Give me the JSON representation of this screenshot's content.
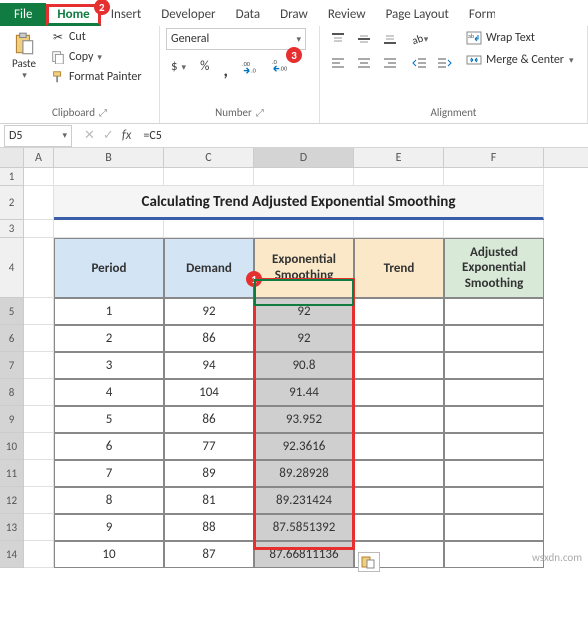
{
  "tabs": {
    "file": "File",
    "home": "Home",
    "insert": "Insert",
    "developer": "Developer",
    "data": "Data",
    "draw": "Draw",
    "review": "Review",
    "page_layout": "Page Layout",
    "formulas_partial": "Form"
  },
  "ribbon": {
    "clipboard": {
      "label": "Clipboard",
      "paste": "Paste",
      "cut": "Cut",
      "copy": "Copy",
      "format_painter": "Format Painter"
    },
    "number": {
      "label": "Number",
      "format": "General",
      "currency": "$",
      "percent": "%",
      "comma": ",",
      "inc_dec": "Increase Decimal",
      "dec_dec": "Decrease Decimal"
    },
    "alignment": {
      "label": "Alignment",
      "wrap": "Wrap Text",
      "merge": "Merge & Center"
    }
  },
  "namebox": "D5",
  "formula": "=C5",
  "columns": [
    "A",
    "B",
    "C",
    "D",
    "E",
    "F"
  ],
  "title": "Calculating Trend Adjusted Exponential Smoothing",
  "headers": {
    "period": "Period",
    "demand": "Demand",
    "exp": "Exponential Smoothing",
    "trend": "Trend",
    "adj": "Adjusted Exponential Smoothing"
  },
  "rows": [
    {
      "n": "5",
      "period": "1",
      "demand": "92",
      "exp": "92",
      "trend": "",
      "adj": ""
    },
    {
      "n": "6",
      "period": "2",
      "demand": "86",
      "exp": "92",
      "trend": "",
      "adj": ""
    },
    {
      "n": "7",
      "period": "3",
      "demand": "94",
      "exp": "90.8",
      "trend": "",
      "adj": ""
    },
    {
      "n": "8",
      "period": "4",
      "demand": "104",
      "exp": "91.44",
      "trend": "",
      "adj": ""
    },
    {
      "n": "9",
      "period": "5",
      "demand": "86",
      "exp": "93.952",
      "trend": "",
      "adj": ""
    },
    {
      "n": "10",
      "period": "6",
      "demand": "77",
      "exp": "92.3616",
      "trend": "",
      "adj": ""
    },
    {
      "n": "11",
      "period": "7",
      "demand": "89",
      "exp": "89.28928",
      "trend": "",
      "adj": ""
    },
    {
      "n": "12",
      "period": "8",
      "demand": "81",
      "exp": "89.231424",
      "trend": "",
      "adj": ""
    },
    {
      "n": "13",
      "period": "9",
      "demand": "88",
      "exp": "87.5851392",
      "trend": "",
      "adj": ""
    },
    {
      "n": "14",
      "period": "10",
      "demand": "87",
      "exp": "87.66811136",
      "trend": "",
      "adj": ""
    }
  ],
  "badges": {
    "b1": "1",
    "b2": "2",
    "b3": "3"
  },
  "watermark": "wsxdn.com",
  "chart_data": {
    "type": "table",
    "title": "Calculating Trend Adjusted Exponential Smoothing",
    "columns": [
      "Period",
      "Demand",
      "Exponential Smoothing",
      "Trend",
      "Adjusted Exponential Smoothing"
    ],
    "data": [
      [
        1,
        92,
        92,
        null,
        null
      ],
      [
        2,
        86,
        92,
        null,
        null
      ],
      [
        3,
        94,
        90.8,
        null,
        null
      ],
      [
        4,
        104,
        91.44,
        null,
        null
      ],
      [
        5,
        86,
        93.952,
        null,
        null
      ],
      [
        6,
        77,
        92.3616,
        null,
        null
      ],
      [
        7,
        89,
        89.28928,
        null,
        null
      ],
      [
        8,
        81,
        89.231424,
        null,
        null
      ],
      [
        9,
        88,
        87.5851392,
        null,
        null
      ],
      [
        10,
        87,
        87.66811136,
        null,
        null
      ]
    ]
  }
}
